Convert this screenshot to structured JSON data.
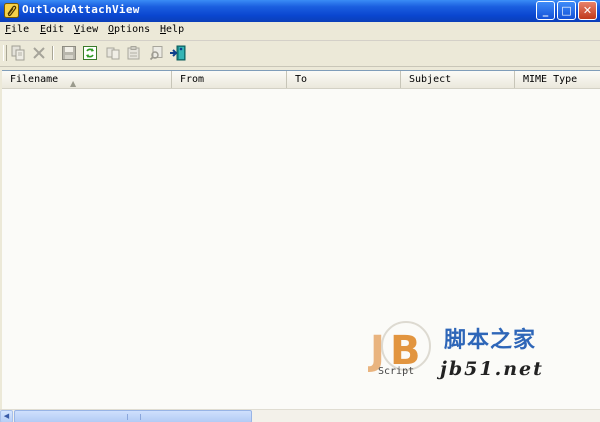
{
  "window": {
    "title": "OutlookAttachView",
    "controls": {
      "minimize": "_",
      "maximize": "□",
      "close": "✕"
    }
  },
  "menu": [
    {
      "label": "File",
      "accel": "F",
      "rest": "ile"
    },
    {
      "label": "Edit",
      "accel": "E",
      "rest": "dit"
    },
    {
      "label": "View",
      "accel": "V",
      "rest": "iew"
    },
    {
      "label": "Options",
      "accel": "O",
      "rest": "ptions"
    },
    {
      "label": "Help",
      "accel": "H",
      "rest": "elp"
    }
  ],
  "toolbar": {
    "icons": [
      "copy-icon",
      "delete-icon",
      "save-icon",
      "refresh-icon",
      "copy-files-icon",
      "properties-icon",
      "find-icon",
      "exit-icon"
    ]
  },
  "columns": [
    "Filename",
    "From",
    "To",
    "Subject",
    "MIME Type"
  ],
  "rows": [],
  "watermark": {
    "logo_letters": "JB",
    "logo_caption": "Script",
    "chinese": "脚本之家",
    "site": "jb51.net"
  },
  "colors": {
    "titlebar": "#0a46d0",
    "chrome": "#ece9d8",
    "list_bg": "#fbfbf8",
    "watermark_blue": "#2e66b8",
    "watermark_orange": "#e08a2c"
  }
}
